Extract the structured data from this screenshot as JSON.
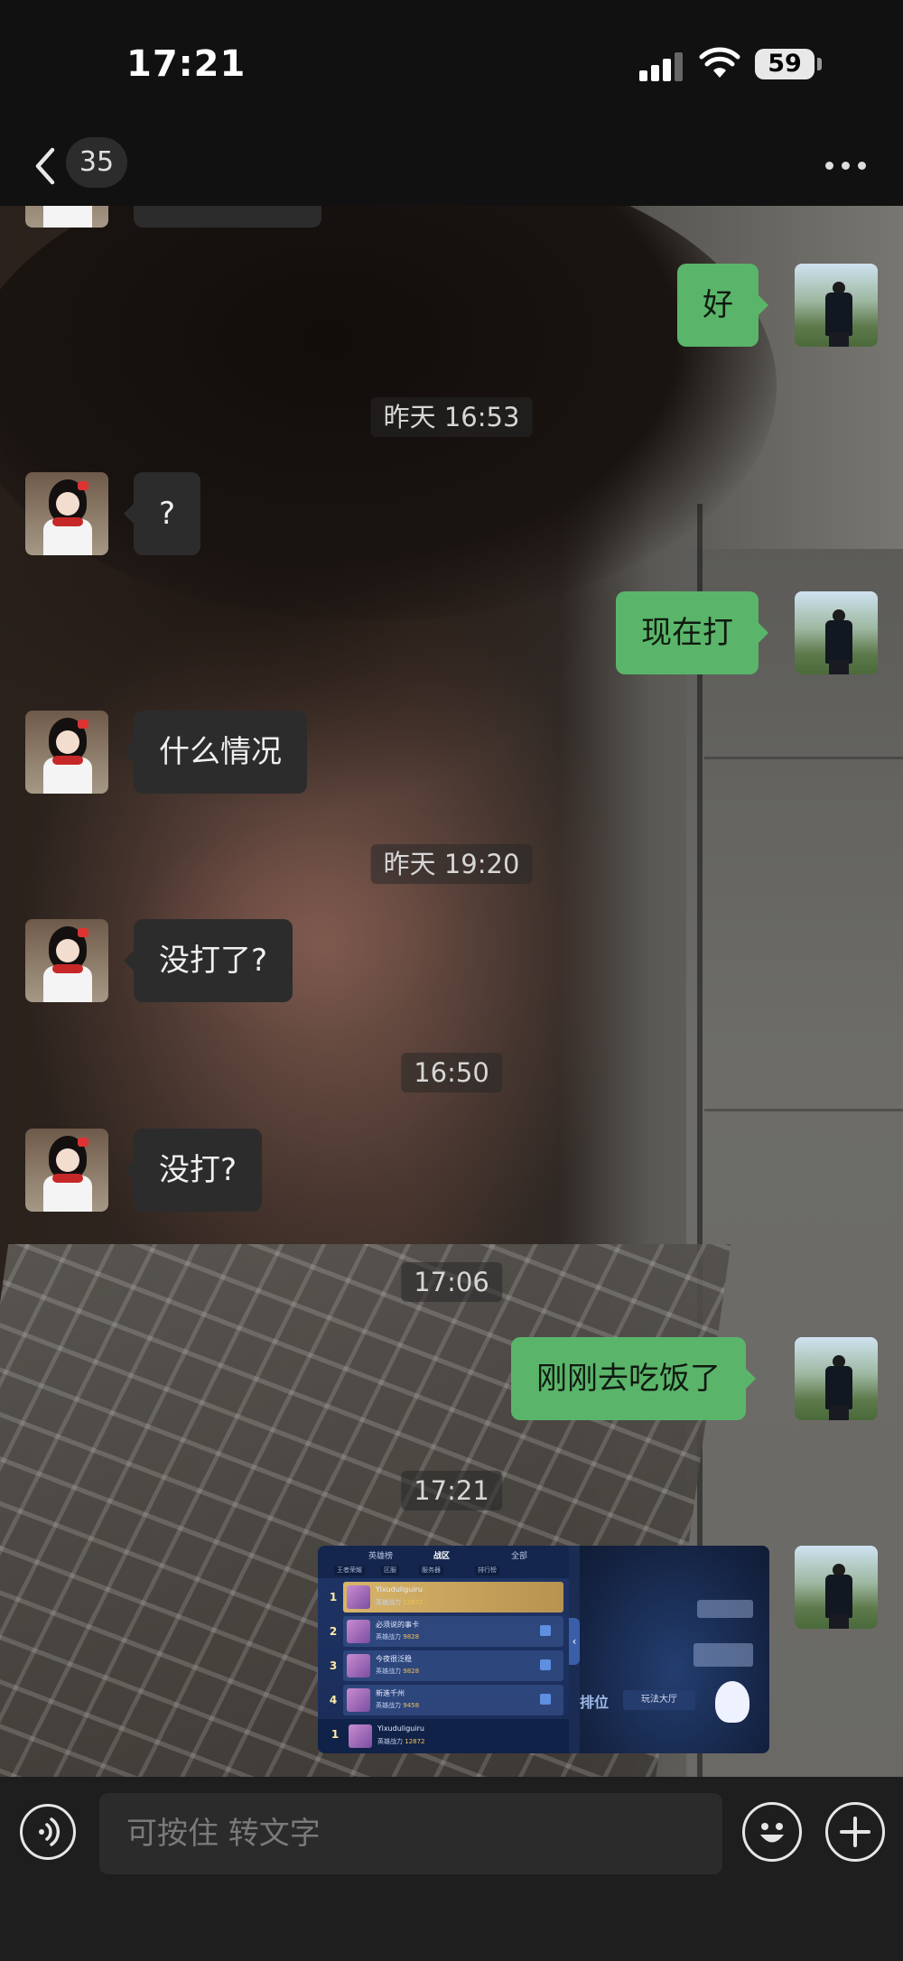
{
  "status_bar": {
    "time": "17:21",
    "battery": "59",
    "signal_icon": "cellular-signal-icon",
    "wifi_icon": "wifi-icon"
  },
  "nav": {
    "back_icon": "chevron-left-icon",
    "unread_count": "35",
    "more_icon": "ellipsis-icon"
  },
  "messages": [
    {
      "side": "out",
      "text": "好"
    },
    {
      "type": "time",
      "text": "昨天 16:53"
    },
    {
      "side": "in",
      "text": "?"
    },
    {
      "side": "out",
      "text": "现在打"
    },
    {
      "side": "in",
      "text": "什么情况"
    },
    {
      "type": "time",
      "text": "昨天 19:20"
    },
    {
      "side": "in",
      "text": "没打了?"
    },
    {
      "type": "time",
      "text": "16:50"
    },
    {
      "side": "in",
      "text": "没打?"
    },
    {
      "type": "time",
      "text": "17:06"
    },
    {
      "side": "out",
      "text": "刚刚去吃饭了"
    },
    {
      "type": "time",
      "text": "17:21"
    },
    {
      "side": "out",
      "type": "image",
      "text": ""
    }
  ],
  "game_screenshot": {
    "tabs": [
      "英雄榜",
      "战区",
      "全部"
    ],
    "filters": [
      "王者荣耀",
      "区服",
      "服务器",
      "排行榜"
    ],
    "rows": [
      {
        "rank": "1",
        "name": "Yixuduliguiru",
        "label": "英雄战力",
        "power": "12872"
      },
      {
        "rank": "2",
        "name": "必须说的事卡",
        "label": "英雄战力",
        "power": "9828"
      },
      {
        "rank": "3",
        "name": "今夜很泛稳",
        "label": "英雄战力",
        "power": "9828"
      },
      {
        "rank": "4",
        "name": "新進千州",
        "label": "英雄战力",
        "power": "9458"
      }
    ],
    "self_row": {
      "rank": "1",
      "name": "Yixuduliguiru",
      "label": "英雄战力",
      "power": "12872"
    },
    "ranked_label": "排位",
    "mode_label": "玩法大厅"
  },
  "input_bar": {
    "placeholder": "可按住 转文字",
    "voice_icon": "voice-icon",
    "emoji_icon": "emoji-icon",
    "add_icon": "plus-icon"
  }
}
